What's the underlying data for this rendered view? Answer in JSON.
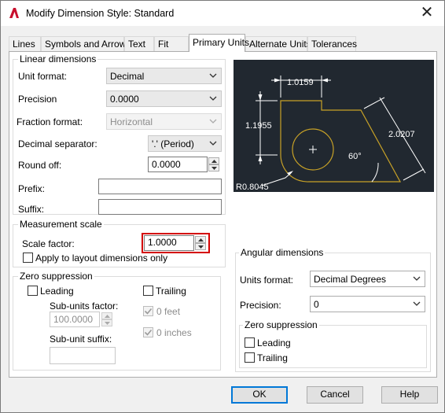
{
  "window": {
    "title": "Modify Dimension Style: Standard",
    "close_glyph": "✕"
  },
  "tabs": [
    {
      "label": "Lines"
    },
    {
      "label": "Symbols and Arrows"
    },
    {
      "label": "Text"
    },
    {
      "label": "Fit"
    },
    {
      "label": "Primary Units",
      "active": true
    },
    {
      "label": "Alternate Units"
    },
    {
      "label": "Tolerances"
    }
  ],
  "linear": {
    "title": "Linear dimensions",
    "unit_format": {
      "label": "Unit format:",
      "value": "Decimal"
    },
    "precision": {
      "label": "Precision",
      "value": "0.0000"
    },
    "fraction_format": {
      "label": "Fraction format:",
      "value": "Horizontal"
    },
    "decimal_separator": {
      "label": "Decimal separator:",
      "value": "'.' (Period)"
    },
    "round_off": {
      "label": "Round off:",
      "value": "0.0000"
    },
    "prefix": {
      "label": "Prefix:",
      "value": ""
    },
    "suffix": {
      "label": "Suffix:",
      "value": ""
    }
  },
  "measurement": {
    "title": "Measurement scale",
    "scale_factor": {
      "label": "Scale factor:",
      "value": "1.0000"
    },
    "apply_layout": {
      "label": "Apply to layout dimensions only",
      "checked": false
    }
  },
  "zero_suppression_linear": {
    "title": "Zero suppression",
    "leading": {
      "label": "Leading",
      "checked": false
    },
    "trailing": {
      "label": "Trailing",
      "checked": false
    },
    "sub_units_factor": {
      "label": "Sub-units factor:",
      "value": "100.0000"
    },
    "sub_unit_suffix": {
      "label": "Sub-unit suffix:",
      "value": ""
    },
    "zero_feet": {
      "label": "0 feet",
      "checked": true
    },
    "zero_inches": {
      "label": "0 inches",
      "checked": true
    }
  },
  "preview": {
    "dim_top": "1.0159",
    "dim_left": "1.1955",
    "dim_right": "2.0207",
    "angle": "60°",
    "radius": "R0.8045",
    "colors": {
      "bg": "#212830",
      "geometry": "#c8a227",
      "dims": "#ffffff"
    }
  },
  "angular": {
    "title": "Angular dimensions",
    "units_format": {
      "label": "Units format:",
      "value": "Decimal Degrees"
    },
    "precision": {
      "label": "Precision:",
      "value": "0"
    },
    "zero_suppression": {
      "title": "Zero suppression",
      "leading": {
        "label": "Leading",
        "checked": false
      },
      "trailing": {
        "label": "Trailing",
        "checked": false
      }
    }
  },
  "buttons": {
    "ok": "OK",
    "cancel": "Cancel",
    "help": "Help"
  },
  "colors": {
    "accent": "#0078d7",
    "highlight": "#d40000",
    "app_icon": "#c8102e"
  }
}
